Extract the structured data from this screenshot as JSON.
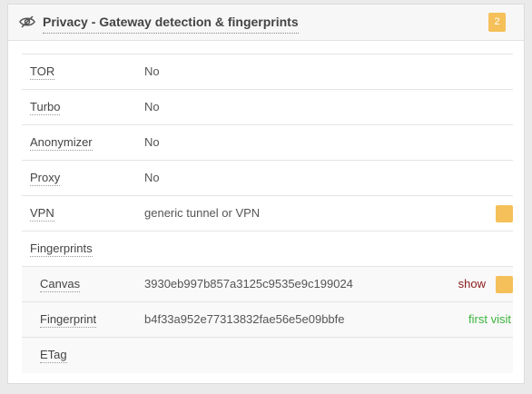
{
  "panel": {
    "title": "Privacy - Gateway detection & fingerprints",
    "icon": "eye-slash-icon",
    "badge_count": "2",
    "badge_color": "#f5c05a"
  },
  "rows": {
    "tor": {
      "label": "TOR",
      "value": "No"
    },
    "turbo": {
      "label": "Turbo",
      "value": "No"
    },
    "anonymizer": {
      "label": "Anonymizer",
      "value": "No"
    },
    "proxy": {
      "label": "Proxy",
      "value": "No"
    },
    "vpn": {
      "label": "VPN",
      "value": "generic tunnel or VPN",
      "flagged": true
    },
    "fingerprints": {
      "label": "Fingerprints"
    },
    "canvas": {
      "label": "Canvas",
      "value": "3930eb997b857a3125c9535e9c199024",
      "action": "show",
      "flagged": true
    },
    "fingerprint": {
      "label": "Fingerprint",
      "value": "b4f33a952e77313832fae56e5e09bbfe",
      "status": "first visit"
    },
    "etag": {
      "label": "ETag",
      "value": ""
    }
  },
  "colors": {
    "flag": "#f5c05a",
    "show_link": "#8b1a1a",
    "first_visit": "#3db33d"
  }
}
